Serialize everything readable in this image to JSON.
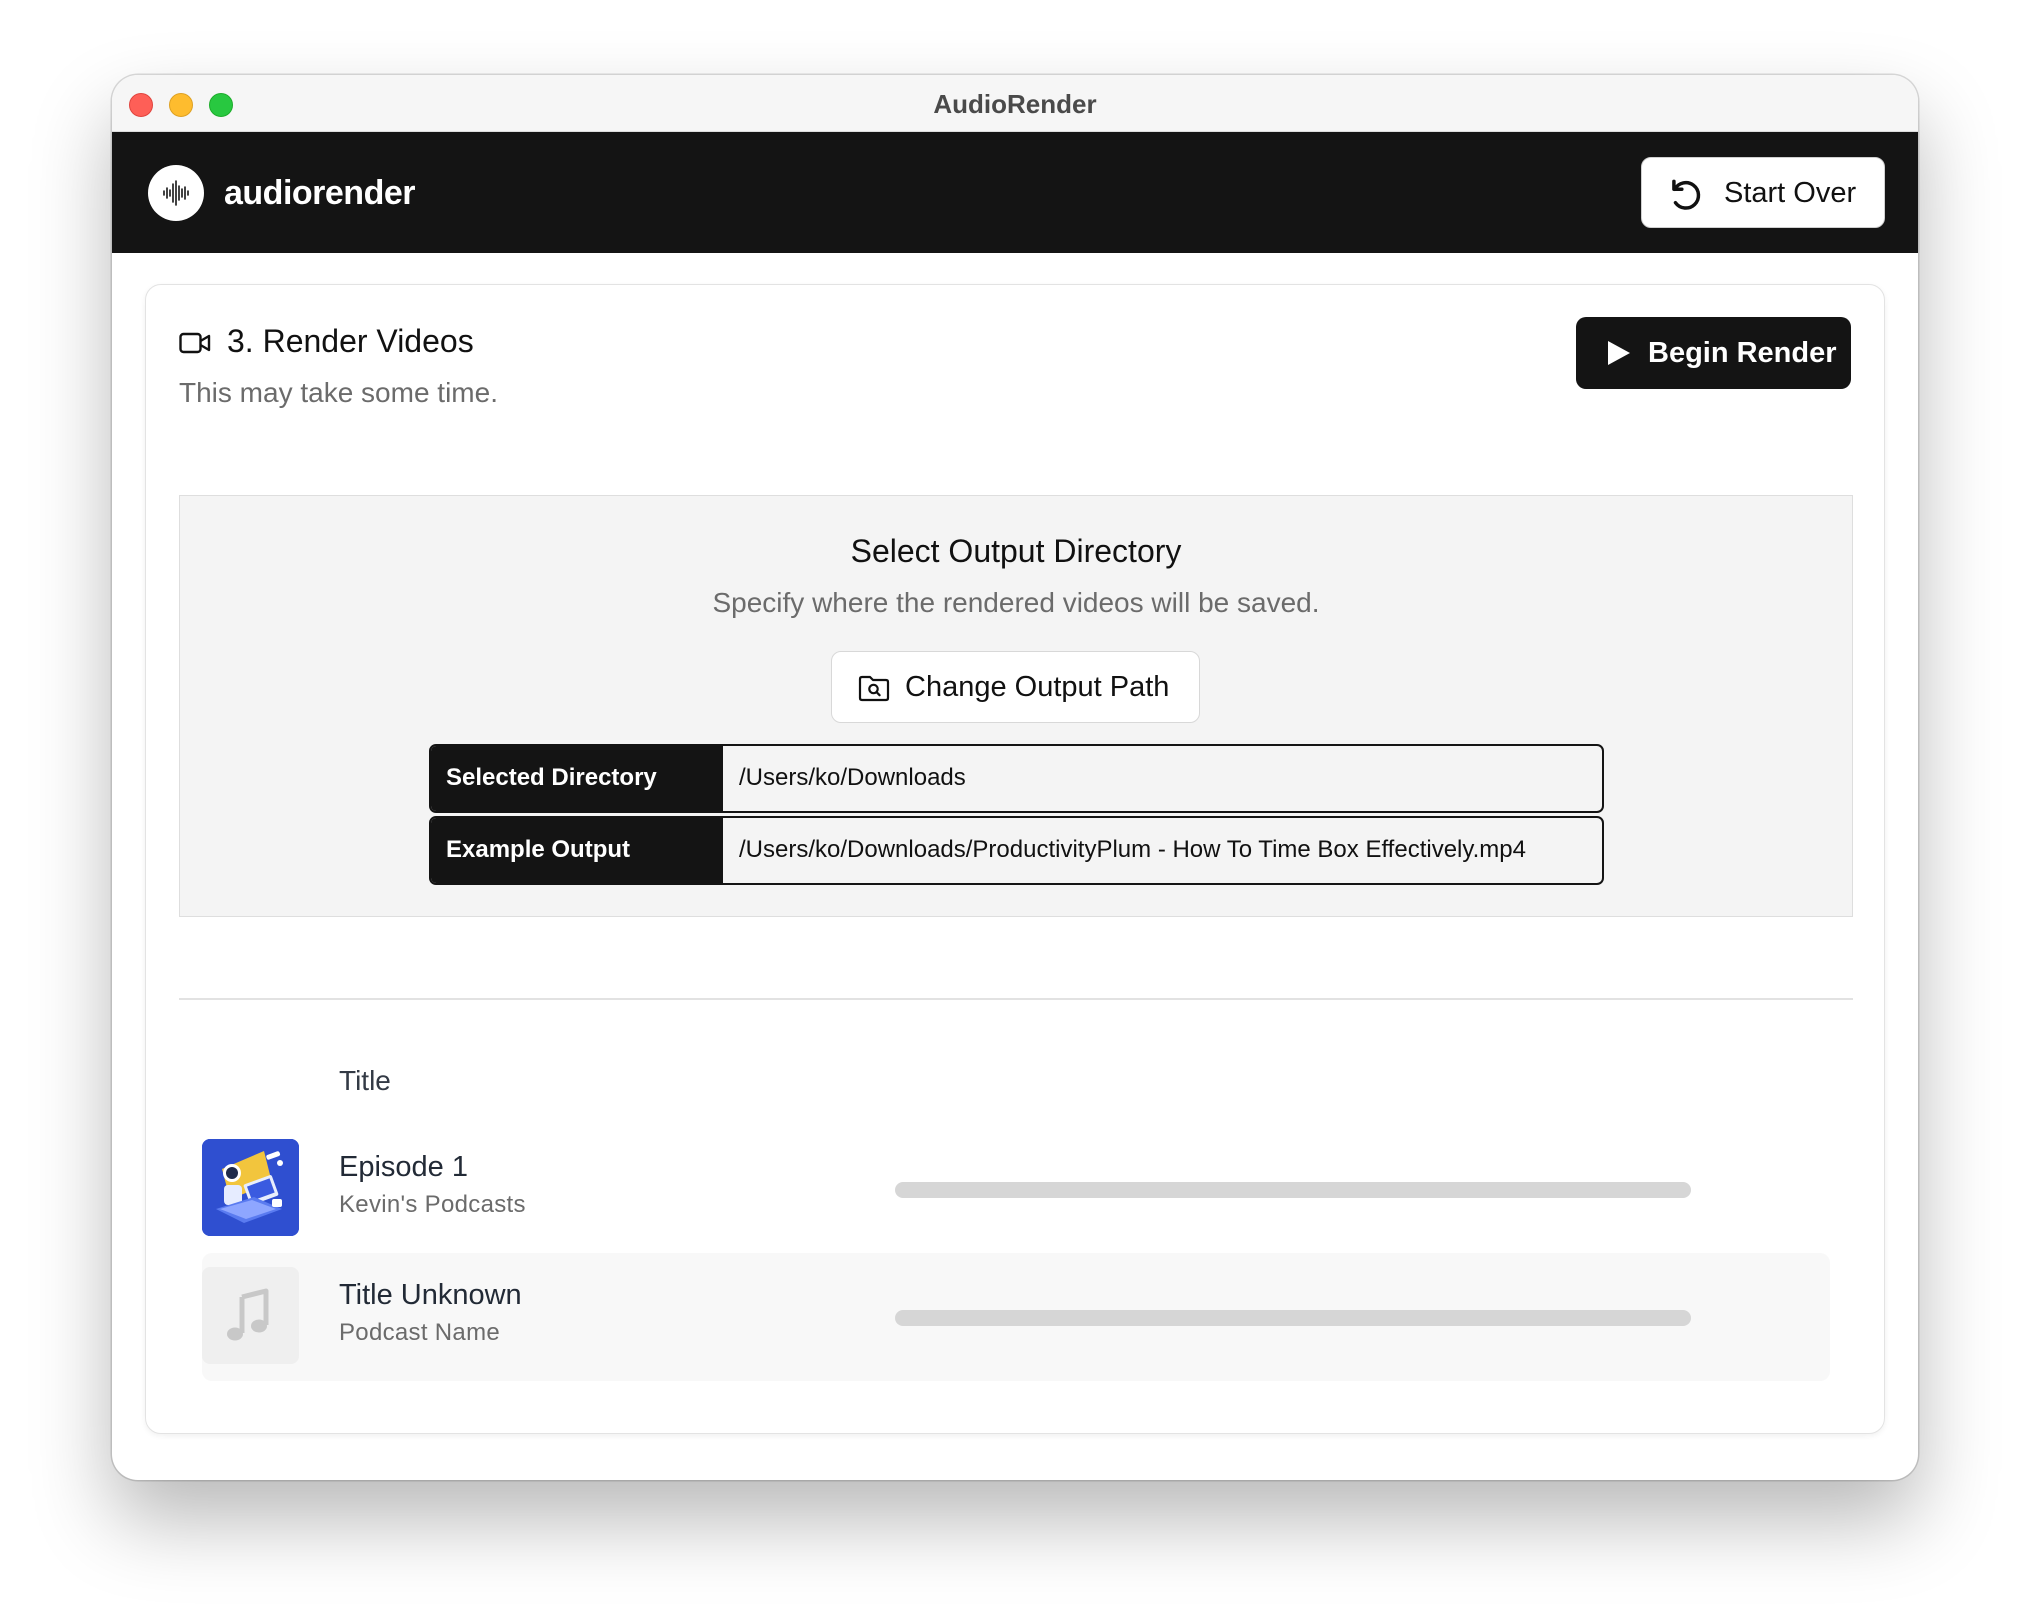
{
  "window": {
    "title": "AudioRender"
  },
  "header": {
    "app_name": "audiorender",
    "start_over_label": "Start Over"
  },
  "step": {
    "title": "3. Render Videos",
    "subtitle": "This may take some time.",
    "begin_label": "Begin Render"
  },
  "output": {
    "title": "Select Output Directory",
    "subtitle": "Specify where the rendered videos will be saved.",
    "change_label": "Change Output Path",
    "rows": [
      {
        "label": "Selected Directory",
        "value": "/Users/ko/Downloads"
      },
      {
        "label": "Example Output",
        "value": "/Users/ko/Downloads/ProductivityPlum - How To Time Box Effectively.mp4"
      }
    ]
  },
  "table": {
    "title_header": "Title",
    "episodes": [
      {
        "title": "Episode 1",
        "podcast": "Kevin's Podcasts",
        "progress": 0,
        "thumb": "podcast-artwork"
      },
      {
        "title": "Title Unknown",
        "podcast": "Podcast Name",
        "progress": 0,
        "thumb": "music-note-icon"
      }
    ]
  },
  "colors": {
    "header_bg": "#141414",
    "panel_bg": "#f4f4f4",
    "progress_track": "#d6d6d6",
    "artwork_bg": "#2f4fd0"
  },
  "icons": [
    "waveform-icon",
    "undo-icon",
    "video-camera-icon",
    "play-icon",
    "folder-search-icon",
    "music-note-icon"
  ]
}
